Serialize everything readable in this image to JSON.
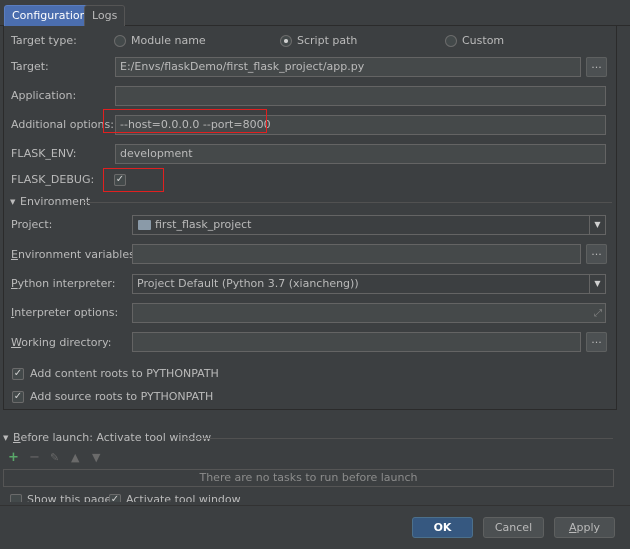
{
  "tabs": [
    {
      "label": "Configuration"
    },
    {
      "label": "Logs"
    }
  ],
  "target_type": {
    "label": "Target type:",
    "options": [
      "Module name",
      "Script path",
      "Custom"
    ],
    "selected": "Script path"
  },
  "target": {
    "label": "Target:",
    "value": "E:/Envs/flaskDemo/first_flask_project/app.py",
    "browse": "..."
  },
  "application": {
    "label": "Application:",
    "value": ""
  },
  "additional_options": {
    "label": "Additional options:",
    "value": "--host=0.0.0.0 --port=8000"
  },
  "flask_env": {
    "label": "FLASK_ENV:",
    "value": "development"
  },
  "flask_debug": {
    "label": "FLASK_DEBUG:",
    "checked": true
  },
  "environment": {
    "header": "Environment",
    "project": {
      "label": "Project:",
      "value": "first_flask_project"
    },
    "env_vars": {
      "label_u": "E",
      "label_rest": "nvironment variables:",
      "value": "",
      "browse": "..."
    },
    "interpreter": {
      "label_u": "P",
      "label_rest": "ython interpreter:",
      "value": "Project Default (Python 3.7 (xiancheng))"
    },
    "interp_options": {
      "label_u": "I",
      "label_rest": "nterpreter options:",
      "value": ""
    },
    "working_dir": {
      "label_u": "W",
      "label_rest": "orking directory:",
      "value": "",
      "browse": "..."
    },
    "add_content_roots": {
      "label": "Add content roots to PYTHONPATH",
      "checked": true
    },
    "add_source_roots": {
      "label": "Add source roots to PYTHONPATH",
      "checked": true
    }
  },
  "before_launch": {
    "header_u": "B",
    "header_rest": "efore launch: Activate tool window",
    "empty_text": "There are no tasks to run before launch",
    "show_this_page": {
      "label": "Show this page",
      "checked": false
    },
    "activate_tool_window": {
      "label": "Activate tool window",
      "checked": true
    }
  },
  "buttons": {
    "ok": "OK",
    "cancel": "Cancel",
    "apply_u": "A",
    "apply_rest": "pply"
  },
  "colors": {
    "accent": "#4b6eaf",
    "highlight": "#e02020",
    "add_icon": "#59a869"
  }
}
